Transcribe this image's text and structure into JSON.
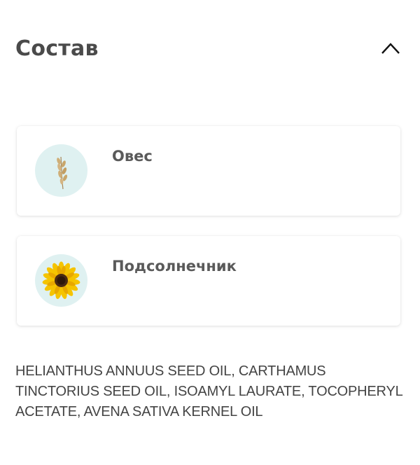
{
  "section": {
    "title": "Состав",
    "toggle_icon": "chevron-up-icon"
  },
  "ingredients": [
    {
      "name": "Овес",
      "icon": "oat-icon"
    },
    {
      "name": "Подсолнечник",
      "icon": "sunflower-icon"
    }
  ],
  "composition": "HELIANTHUS ANNUUS SEED OIL, CARTHAMUS TINCTORIUS SEED OIL, ISOAMYL LAURATE, TOCOPHERYL ACETATE, AVENA SATIVA KERNEL OIL",
  "colors": {
    "icon_background": "#dff1f1",
    "sunflower_petals": "#f5c400",
    "sunflower_center": "#4a2a12",
    "oat": "#c9a66b"
  }
}
